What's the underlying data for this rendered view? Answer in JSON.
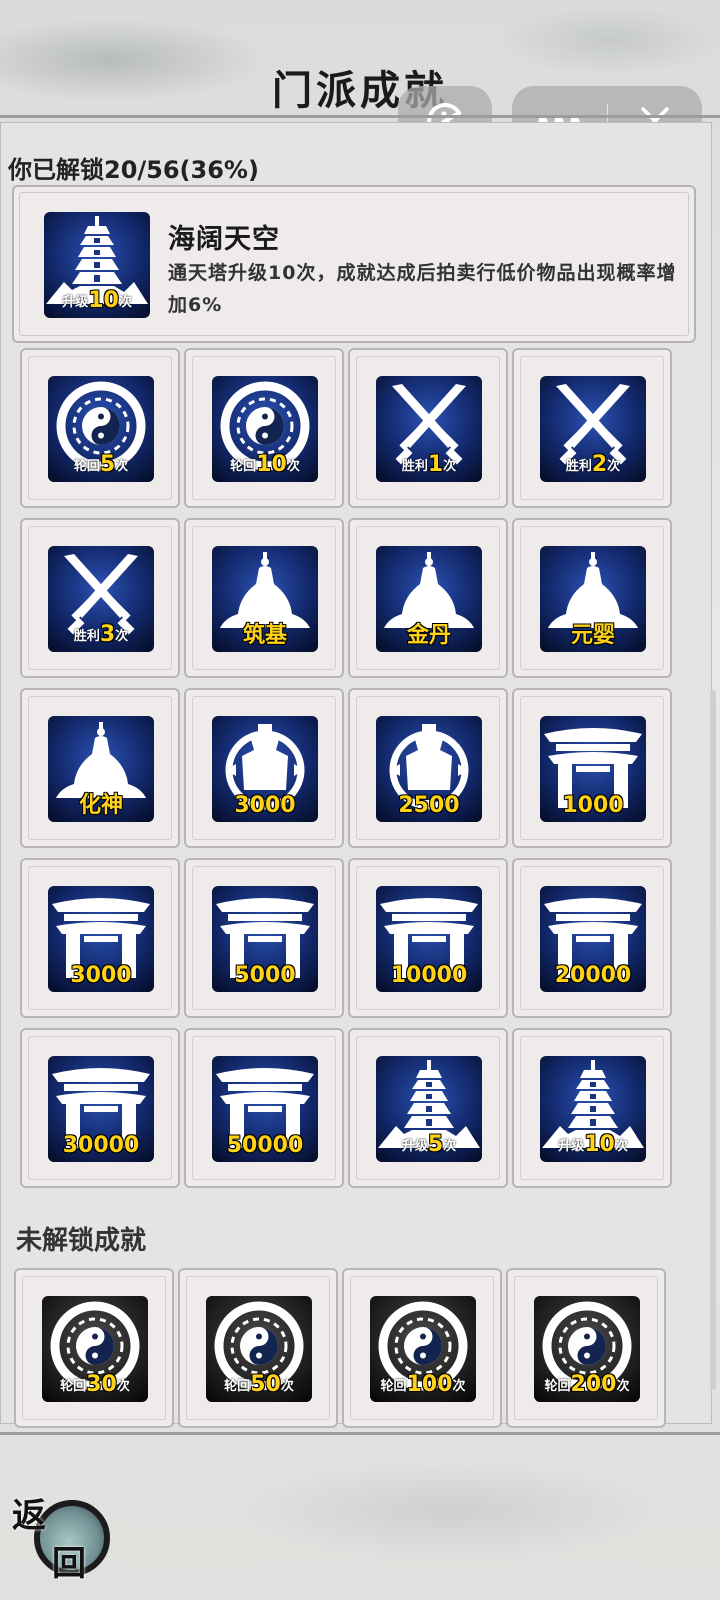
{
  "title": "门派成就",
  "unlocked_summary": "你已解锁20/56(36%)",
  "featured": {
    "name": "海阔天空",
    "description": "通天塔升级10次，成就达成后拍卖行低价物品出现概率增加6%",
    "icon": "pagoda-icon",
    "caption_prefix": "升级",
    "caption_num": "10",
    "caption_suffix": "次"
  },
  "unlocked": [
    {
      "icon": "yinyang-icon",
      "prefix": "轮回",
      "num": "5",
      "suffix": "次"
    },
    {
      "icon": "yinyang-icon",
      "prefix": "轮回",
      "num": "10",
      "suffix": "次"
    },
    {
      "icon": "crossed-swords-icon",
      "prefix": "胜利",
      "num": "1",
      "suffix": "次"
    },
    {
      "icon": "crossed-swords-icon",
      "prefix": "胜利",
      "num": "2",
      "suffix": "次"
    },
    {
      "icon": "crossed-swords-icon",
      "prefix": "胜利",
      "num": "3",
      "suffix": "次"
    },
    {
      "icon": "immortal-icon",
      "label": "筑基"
    },
    {
      "icon": "immortal-icon",
      "label": "金丹"
    },
    {
      "icon": "immortal-icon",
      "label": "元婴"
    },
    {
      "icon": "immortal-icon",
      "label": "化神"
    },
    {
      "icon": "cauldron-icon",
      "label": "3000"
    },
    {
      "icon": "cauldron-icon",
      "label": "2500"
    },
    {
      "icon": "gate-icon",
      "label": "1000"
    },
    {
      "icon": "gate-icon",
      "label": "3000"
    },
    {
      "icon": "gate-icon",
      "label": "5000"
    },
    {
      "icon": "gate-icon",
      "label": "10000"
    },
    {
      "icon": "gate-icon",
      "label": "20000"
    },
    {
      "icon": "gate-icon",
      "label": "30000"
    },
    {
      "icon": "gate-icon",
      "label": "50000"
    },
    {
      "icon": "pagoda-icon",
      "prefix": "升级",
      "num": "5",
      "suffix": "次"
    },
    {
      "icon": "pagoda-icon",
      "prefix": "升级",
      "num": "10",
      "suffix": "次"
    }
  ],
  "locked_label": "未解锁成就",
  "locked": [
    {
      "icon": "yinyang-icon",
      "prefix": "轮回",
      "num": "30",
      "suffix": "次"
    },
    {
      "icon": "yinyang-icon",
      "prefix": "轮回",
      "num": "50",
      "suffix": "次"
    },
    {
      "icon": "yinyang-icon",
      "prefix": "轮回",
      "num": "100",
      "suffix": "次"
    },
    {
      "icon": "yinyang-icon",
      "prefix": "轮回",
      "num": "200",
      "suffix": "次"
    }
  ],
  "back_label_1": "返",
  "back_label_2": "回",
  "colors": {
    "icon_bg": "#12286a",
    "number": "#ffd21a",
    "locked_bg": "#202020"
  }
}
